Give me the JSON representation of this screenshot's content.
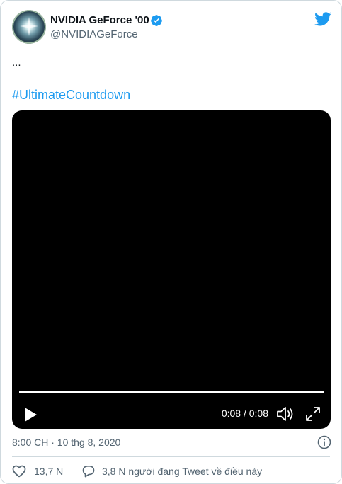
{
  "author": {
    "display_name": "NVIDIA GeForce '00",
    "handle": "@NVIDIAGeForce",
    "verified": true,
    "avatar_icon": "nvidia-geforce-avatar"
  },
  "tweet": {
    "text": "...",
    "hashtag": "#UltimateCountdown"
  },
  "video": {
    "time_display": "0:08 / 0:08",
    "progress": 1.0,
    "play_icon": "play-icon",
    "volume_icon": "volume-icon",
    "fullscreen_icon": "fullscreen-icon"
  },
  "meta": {
    "timestamp": "8:00 CH · 10 thg 8, 2020",
    "info_icon": "info-icon"
  },
  "actions": {
    "like_count": "13,7 N",
    "reply_text": "3,8 N người đang Tweet về điều này"
  },
  "colors": {
    "brand_blue": "#1d9bf0",
    "text_primary": "#0f1419",
    "text_secondary": "#536471",
    "border": "#cfd9de"
  }
}
